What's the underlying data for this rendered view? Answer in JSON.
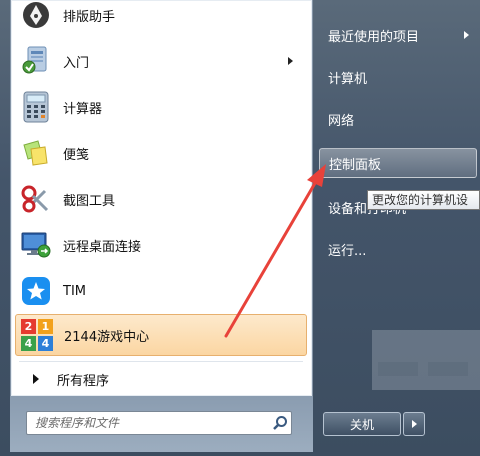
{
  "programs": [
    {
      "label": "排版助手",
      "icon": "pen-nib-icon"
    },
    {
      "label": "入门",
      "icon": "getting-started-icon",
      "has_submenu": true
    },
    {
      "label": "计算器",
      "icon": "calculator-icon"
    },
    {
      "label": "便笺",
      "icon": "sticky-notes-icon"
    },
    {
      "label": "截图工具",
      "icon": "scissors-icon"
    },
    {
      "label": "远程桌面连接",
      "icon": "remote-desktop-icon"
    },
    {
      "label": "TIM",
      "icon": "tim-icon"
    },
    {
      "label": "2144游戏中心",
      "icon": "game-center-icon",
      "highlighted": true
    }
  ],
  "all_programs": {
    "label": "所有程序"
  },
  "search": {
    "placeholder": "搜索程序和文件"
  },
  "right_items": [
    {
      "label": "最近使用的项目",
      "has_submenu": true
    },
    {
      "label": "计算机"
    },
    {
      "label": "网络"
    },
    {
      "label": "控制面板",
      "hover": true
    },
    {
      "label": "设备和打印机"
    },
    {
      "label": "运行..."
    }
  ],
  "tooltip": {
    "text": "更改您的计算机设"
  },
  "shutdown": {
    "label": "关机"
  },
  "game_icon_tiles": [
    "2",
    "1",
    "4",
    "4"
  ],
  "colors": {
    "accent_arrow": "#e8423a",
    "highlight": "#fbd6a2"
  }
}
